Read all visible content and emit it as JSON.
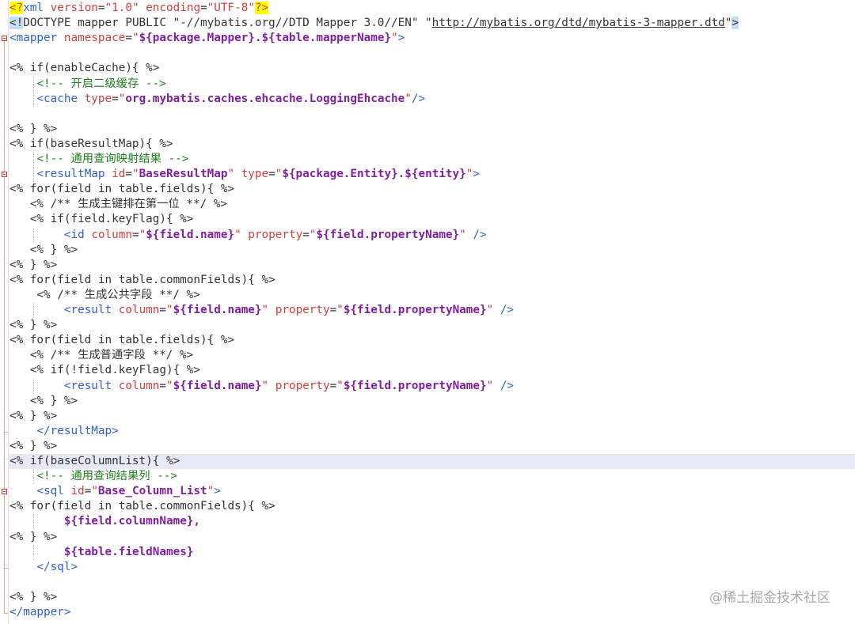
{
  "editor": {
    "lines": [
      [
        [
          "pi",
          "<?"
        ],
        [
          "tag",
          "xml "
        ],
        [
          "attr",
          "version"
        ],
        [
          "t",
          "="
        ],
        [
          "attr",
          "\"1.0\" "
        ],
        [
          "attr",
          "encoding"
        ],
        [
          "t",
          "="
        ],
        [
          "attr",
          "\"UTF-8\""
        ],
        [
          "pi",
          "?>"
        ]
      ],
      [
        [
          "pisel",
          "<!"
        ],
        [
          "t",
          "DOCTYPE mapper PUBLIC \"-//mybatis.org//DTD Mapper 3.0//EN\" \""
        ],
        [
          "url",
          "http://mybatis.org/dtd/mybatis-3-mapper.dtd"
        ],
        [
          "t",
          "\""
        ],
        [
          "pisel",
          ">"
        ]
      ],
      [
        [
          "tag",
          "<mapper "
        ],
        [
          "attr",
          "namespace"
        ],
        [
          "t",
          "="
        ],
        [
          "attr",
          "\""
        ],
        [
          "val",
          "${package.Mapper}.${table.mapperName}"
        ],
        [
          "attr",
          "\""
        ],
        [
          "tag",
          ">"
        ]
      ],
      [],
      [
        [
          "t",
          "<% if(enableCache){ %>"
        ]
      ],
      [
        [
          "t",
          "    "
        ],
        [
          "cmt",
          "<!-- 开启二级缓存 -->"
        ]
      ],
      [
        [
          "t",
          "    "
        ],
        [
          "tag",
          "<cache "
        ],
        [
          "attr",
          "type"
        ],
        [
          "t",
          "="
        ],
        [
          "attr",
          "\""
        ],
        [
          "val",
          "org.mybatis.caches.ehcache.LoggingEhcache"
        ],
        [
          "attr",
          "\""
        ],
        [
          "tag",
          "/>"
        ]
      ],
      [],
      [
        [
          "t",
          "<% } %>"
        ]
      ],
      [
        [
          "t",
          "<% if(baseResultMap){ %>"
        ]
      ],
      [
        [
          "t",
          "    "
        ],
        [
          "cmt",
          "<!-- 通用查询映射结果 -->"
        ]
      ],
      [
        [
          "t",
          "    "
        ],
        [
          "tag",
          "<resultMap "
        ],
        [
          "attr",
          "id"
        ],
        [
          "t",
          "="
        ],
        [
          "attr",
          "\""
        ],
        [
          "val",
          "BaseResultMap"
        ],
        [
          "attr",
          "\" "
        ],
        [
          "attr",
          "type"
        ],
        [
          "t",
          "="
        ],
        [
          "attr",
          "\""
        ],
        [
          "val",
          "${package.Entity}.${entity}"
        ],
        [
          "attr",
          "\""
        ],
        [
          "tag",
          ">"
        ]
      ],
      [
        [
          "t",
          "<% for(field in table.fields){ %>"
        ]
      ],
      [
        [
          "t",
          "   <% /** 生成主键排在第一位 **/ %>"
        ]
      ],
      [
        [
          "t",
          "   <% if(field.keyFlag){ %>"
        ]
      ],
      [
        [
          "t",
          "        "
        ],
        [
          "tag",
          "<id "
        ],
        [
          "attr",
          "column"
        ],
        [
          "t",
          "="
        ],
        [
          "attr",
          "\""
        ],
        [
          "val",
          "${field.name}"
        ],
        [
          "attr",
          "\" "
        ],
        [
          "attr",
          "property"
        ],
        [
          "t",
          "="
        ],
        [
          "attr",
          "\""
        ],
        [
          "val",
          "${field.propertyName}"
        ],
        [
          "attr",
          "\" "
        ],
        [
          "tag",
          "/>"
        ]
      ],
      [
        [
          "t",
          "   <% } %>"
        ]
      ],
      [
        [
          "t",
          "<% } %>"
        ]
      ],
      [
        [
          "t",
          "<% for(field in table.commonFields){ %>"
        ]
      ],
      [
        [
          "t",
          "    <% /** 生成公共字段 **/ %>"
        ]
      ],
      [
        [
          "t",
          "        "
        ],
        [
          "tag",
          "<result "
        ],
        [
          "attr",
          "column"
        ],
        [
          "t",
          "="
        ],
        [
          "attr",
          "\""
        ],
        [
          "val",
          "${field.name}"
        ],
        [
          "attr",
          "\" "
        ],
        [
          "attr",
          "property"
        ],
        [
          "t",
          "="
        ],
        [
          "attr",
          "\""
        ],
        [
          "val",
          "${field.propertyName}"
        ],
        [
          "attr",
          "\" "
        ],
        [
          "tag",
          "/>"
        ]
      ],
      [
        [
          "t",
          "<% } %>"
        ]
      ],
      [
        [
          "t",
          "<% for(field in table.fields){ %>"
        ]
      ],
      [
        [
          "t",
          "   <% /** 生成普通字段 **/ %>"
        ]
      ],
      [
        [
          "t",
          "   <% if(!field.keyFlag){ %>"
        ]
      ],
      [
        [
          "t",
          "        "
        ],
        [
          "tag",
          "<result "
        ],
        [
          "attr",
          "column"
        ],
        [
          "t",
          "="
        ],
        [
          "attr",
          "\""
        ],
        [
          "val",
          "${field.name}"
        ],
        [
          "attr",
          "\" "
        ],
        [
          "attr",
          "property"
        ],
        [
          "t",
          "="
        ],
        [
          "attr",
          "\""
        ],
        [
          "val",
          "${field.propertyName}"
        ],
        [
          "attr",
          "\" "
        ],
        [
          "tag",
          "/>"
        ]
      ],
      [
        [
          "t",
          "   <% } %>"
        ]
      ],
      [
        [
          "t",
          "<% } %>"
        ]
      ],
      [
        [
          "t",
          "    "
        ],
        [
          "tag",
          "</resultMap>"
        ]
      ],
      [
        [
          "t",
          "<% } %>"
        ]
      ],
      [
        [
          "t",
          "<% if(baseColumnList){ %>"
        ]
      ],
      [
        [
          "t",
          "    "
        ],
        [
          "cmt",
          "<!-- 通用查询结果列 -->"
        ]
      ],
      [
        [
          "t",
          "    "
        ],
        [
          "tag",
          "<sql "
        ],
        [
          "attr",
          "id"
        ],
        [
          "t",
          "="
        ],
        [
          "attr",
          "\""
        ],
        [
          "val",
          "Base_Column_List"
        ],
        [
          "attr",
          "\""
        ],
        [
          "tag",
          ">"
        ]
      ],
      [
        [
          "t",
          "<% for(field in table.commonFields){ %>"
        ]
      ],
      [
        [
          "t",
          "        "
        ],
        [
          "val",
          "${field.columnName},"
        ]
      ],
      [
        [
          "t",
          "<% } %>"
        ]
      ],
      [
        [
          "t",
          "        "
        ],
        [
          "val",
          "${table.fieldNames}"
        ]
      ],
      [
        [
          "t",
          "    "
        ],
        [
          "tag",
          "</sql>"
        ]
      ],
      [],
      [
        [
          "t",
          "<% } %>"
        ]
      ],
      [
        [
          "tag",
          "</mapper>"
        ]
      ]
    ],
    "highlighted_line": 30
  },
  "watermark": "@稀土掘金技术社区"
}
